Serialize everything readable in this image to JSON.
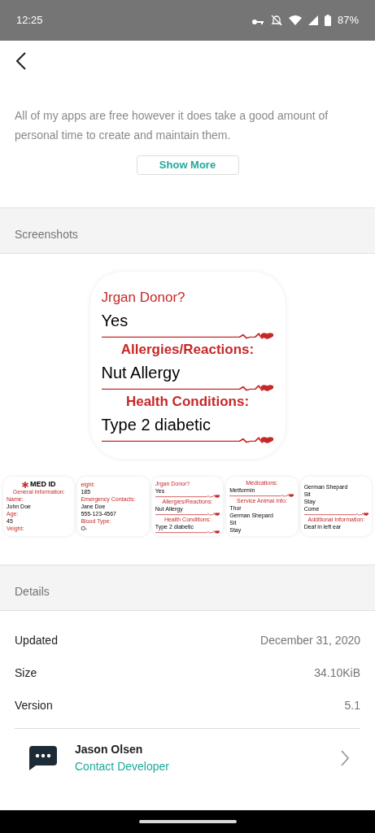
{
  "status_bar": {
    "time": "12:25",
    "battery": "87%"
  },
  "description": {
    "text": "All of my apps are free however it does take a good amount of personal time to create and maintain them.",
    "button": "Show More"
  },
  "screenshots": {
    "title": "Screenshots",
    "main": [
      {
        "kind": "side_label",
        "text": "Jrgan Donor?"
      },
      {
        "kind": "value",
        "text": "Yes"
      },
      {
        "kind": "divider"
      },
      {
        "kind": "label",
        "text": "Allergies/Reactions:"
      },
      {
        "kind": "value",
        "text": "Nut Allergy"
      },
      {
        "kind": "divider"
      },
      {
        "kind": "label",
        "text": "Health Conditions:"
      },
      {
        "kind": "value",
        "text": "Type 2 diabetic"
      },
      {
        "kind": "divider"
      }
    ],
    "thumbnails": [
      [
        {
          "kind": "logo",
          "text": "MED ID"
        },
        {
          "kind": "label",
          "text": "General Information:"
        },
        {
          "kind": "side_label",
          "text": "Name:"
        },
        {
          "kind": "value",
          "text": "John Doe"
        },
        {
          "kind": "side_label",
          "text": "Age:"
        },
        {
          "kind": "value",
          "text": "45"
        },
        {
          "kind": "side_label",
          "text": "Veight:"
        }
      ],
      [
        {
          "kind": "side_label",
          "text": "eight:"
        },
        {
          "kind": "value",
          "text": "185"
        },
        {
          "kind": "side_label",
          "text": "Emergency Contacts:"
        },
        {
          "kind": "value",
          "text": "Jane Doe"
        },
        {
          "kind": "value",
          "text": "555-123-4567"
        },
        {
          "kind": "side_label",
          "text": "Blood Type:"
        },
        {
          "kind": "value",
          "text": "O-"
        }
      ],
      [
        {
          "kind": "side_label",
          "text": "Jrgan Donor?"
        },
        {
          "kind": "value",
          "text": "Yes"
        },
        {
          "kind": "divider"
        },
        {
          "kind": "label",
          "text": "Allergies/Reactions:"
        },
        {
          "kind": "value",
          "text": "Nut Allergy"
        },
        {
          "kind": "divider"
        },
        {
          "kind": "label",
          "text": "Health Conditions:"
        },
        {
          "kind": "value",
          "text": "Type 2 diabetic"
        },
        {
          "kind": "divider"
        }
      ],
      [
        {
          "kind": "label",
          "text": "Medications:"
        },
        {
          "kind": "value",
          "text": "Metformin"
        },
        {
          "kind": "divider"
        },
        {
          "kind": "label",
          "text": "Service Animal Info:"
        },
        {
          "kind": "value",
          "text": "Thor"
        },
        {
          "kind": "value",
          "text": "German Shepard"
        },
        {
          "kind": "value",
          "text": "Sit"
        },
        {
          "kind": "value",
          "text": "Stay"
        }
      ],
      [
        {
          "kind": "value",
          "text": "German Shepard"
        },
        {
          "kind": "value",
          "text": "Sit"
        },
        {
          "kind": "value",
          "text": "Stay"
        },
        {
          "kind": "value",
          "text": "Come"
        },
        {
          "kind": "divider"
        },
        {
          "kind": "label",
          "text": "Additional Information:"
        },
        {
          "kind": "value",
          "text": "Deaf in left ear"
        }
      ]
    ]
  },
  "details": {
    "title": "Details",
    "rows": [
      {
        "label": "Updated",
        "value": "December 31, 2020"
      },
      {
        "label": "Size",
        "value": "34.10KiB"
      },
      {
        "label": "Version",
        "value": "5.1"
      }
    ]
  },
  "developer": {
    "name": "Jason Olsen",
    "link": "Contact Developer"
  }
}
